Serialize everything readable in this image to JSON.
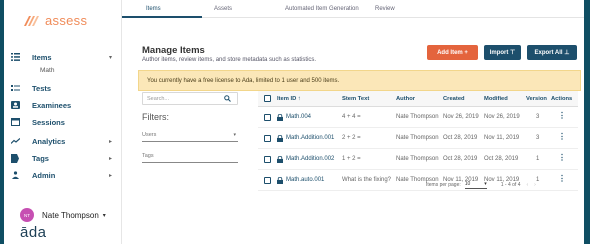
{
  "sidebar": {
    "logo_text": "assess",
    "items": [
      {
        "label": "Items",
        "icon": "list-icon",
        "has_chevron": true,
        "chevron": "▾"
      },
      {
        "label": "Tests",
        "icon": "tests-icon",
        "has_chevron": false
      },
      {
        "label": "Examinees",
        "icon": "person-card-icon",
        "has_chevron": false
      },
      {
        "label": "Sessions",
        "icon": "calendar-icon",
        "has_chevron": false
      },
      {
        "label": "Analytics",
        "icon": "trend-icon",
        "has_chevron": true,
        "chevron": "▸"
      },
      {
        "label": "Tags",
        "icon": "tag-icon",
        "has_chevron": true,
        "chevron": "▸"
      },
      {
        "label": "Admin",
        "icon": "admin-icon",
        "has_chevron": true,
        "chevron": "▸"
      }
    ],
    "sub_item": "Math",
    "user": {
      "initials": "NT",
      "name": "Nate Thompson",
      "chevron": "▾"
    },
    "brand": "āda"
  },
  "tabs": [
    "Items",
    "Assets",
    "Automated Item Generation",
    "Review"
  ],
  "active_tab": "Items",
  "main": {
    "title": "Manage Items",
    "subtitle": "Author items, review items, and store metadata such as statistics.",
    "buttons": {
      "add": "Add Item +",
      "import": "Import ⊤",
      "export": "Export All ⊥"
    },
    "banner": "You currently have a free license to Ada, limited to 1 user and 500 items."
  },
  "filters": {
    "search_placeholder": "Search...",
    "title": "Filters:",
    "users": "Users",
    "tags": "Tags"
  },
  "table": {
    "headers": {
      "id": "Item ID ↑",
      "stem": "Stem Text",
      "author": "Author",
      "created": "Created",
      "modified": "Modified",
      "version": "Version",
      "actions": "Actions"
    },
    "rows": [
      {
        "id": "Math.004",
        "stem": "4 + 4 =",
        "author": "Nate Thompson",
        "created": "Nov 26, 2019",
        "modified": "Nov 26, 2019",
        "version": "3"
      },
      {
        "id": "Math.Addition.001",
        "stem": "2 + 2 =",
        "author": "Nate Thompson",
        "created": "Oct 28, 2019",
        "modified": "Nov 11, 2019",
        "version": "3"
      },
      {
        "id": "Math.Addition.002",
        "stem": "1 + 2 =",
        "author": "Nate Thompson",
        "created": "Oct 28, 2019",
        "modified": "Oct 28, 2019",
        "version": "1"
      },
      {
        "id": "Math.auto.001",
        "stem": "What is the fixing?",
        "author": "Nate Thompson",
        "created": "Nov 11, 2019",
        "modified": "Nov 11, 2019",
        "version": "1"
      }
    ]
  },
  "pager": {
    "label": "Items per page:",
    "value": "10",
    "range": "1 - 4 of 4",
    "prev": "‹",
    "next": "›"
  },
  "colors": {
    "primary": "#1d4f6c",
    "accent": "#e4643d",
    "banner": "#fbe7b8",
    "frame": "#0f4e63",
    "logo": "#f08c5a"
  }
}
